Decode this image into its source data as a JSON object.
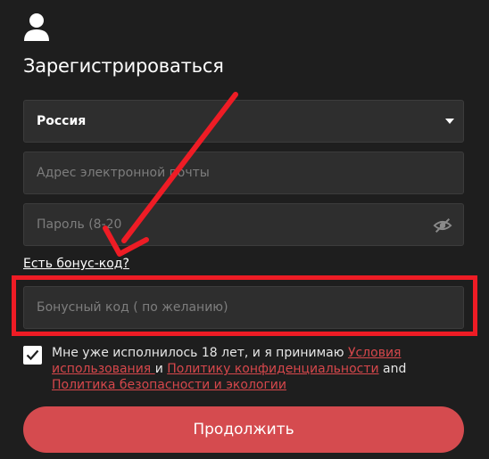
{
  "form": {
    "title": "Зарегистрироваться",
    "country": {
      "value": "Россия"
    },
    "email": {
      "placeholder": "Адрес электронной почты"
    },
    "password": {
      "placeholder": "Пароль (8-20"
    },
    "bonus_link": "Есть бонус-код?",
    "bonus": {
      "placeholder": "Бонусный код ( по желанию)"
    },
    "terms": {
      "checked": true,
      "text_1": "Мне уже исполнилось 18 лет, и я принимаю ",
      "link_1": "Условия использования ",
      "text_2": "и ",
      "link_2": "Политику конфиденциальности",
      "text_3": " and ",
      "link_3": "Политика безопасности и экологии"
    },
    "continue_label": "Продолжить"
  },
  "icons": {
    "user": "user-icon",
    "caret": "caret-down-icon",
    "eye": "eye-slash-icon",
    "check": "checkmark-icon"
  },
  "colors": {
    "background": "#1e1e1e",
    "field": "#2e2e2e",
    "accent": "#d54b4f",
    "link": "#d5474b",
    "annotation": "#ee1c25"
  }
}
